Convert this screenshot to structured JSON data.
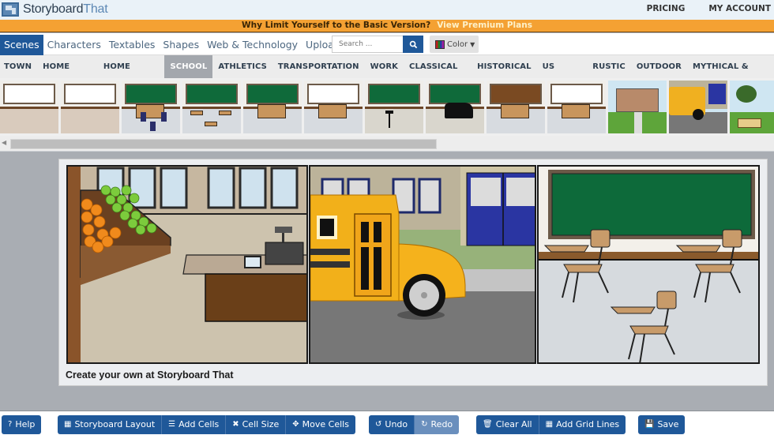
{
  "header": {
    "brand_main": "Storyboard",
    "brand_accent": "That",
    "links": [
      "PRICING",
      "MY ACCOUNT"
    ]
  },
  "promo": {
    "text": "Why Limit Yourself to the Basic Version?",
    "cta": "View Premium Plans"
  },
  "library": {
    "tabs": [
      "Scenes",
      "Characters",
      "Textables",
      "Shapes",
      "Web & Technology",
      "Upload"
    ],
    "active_tab": "Scenes",
    "search_placeholder": "Search ...",
    "color_label": "Color"
  },
  "categories": {
    "items": [
      "TOWN",
      "HOME (INDOOR)",
      "HOME (OUTDOOR)",
      "SCHOOL",
      "ATHLETICS",
      "TRANSPORTATION",
      "WORK",
      "CLASSICAL HOMES",
      "HISTORICAL",
      "US HISTORY",
      "RUSTIC",
      "OUTDOOR",
      "MYTHICAL & FUTURISTIC"
    ],
    "active": "SCHOOL"
  },
  "thumbnails": [
    {
      "name": "cafeteria-whiteboard",
      "board": "#ffffff",
      "floor": "#d9cbbd"
    },
    {
      "name": "art-room",
      "board": "#ffffff",
      "floor": "#d9cbbd"
    },
    {
      "name": "classroom-desks",
      "board": "#0f6a3a",
      "floor": "#d7dbe0"
    },
    {
      "name": "classroom-chairs",
      "board": "#0f6a3a",
      "floor": "#d7dbe0"
    },
    {
      "name": "classroom-teacher-desk",
      "board": "#0f6a3a",
      "floor": "#d7dbe0"
    },
    {
      "name": "whiteboard-teacher-desk",
      "board": "#ffffff",
      "floor": "#d7dbe0"
    },
    {
      "name": "music-room-stands",
      "board": "#0f6a3a",
      "floor": "#d9d6cd"
    },
    {
      "name": "music-room-piano",
      "board": "#0f6a3a",
      "floor": "#d9d6cd"
    },
    {
      "name": "science-cabinets",
      "board": "#7a4a22",
      "floor": "#d7dbe0"
    },
    {
      "name": "science-lab",
      "board": "#ffffff",
      "floor": "#d7dbe0"
    },
    {
      "name": "school-exterior",
      "board": "#b88a6a",
      "floor": "#5ea53a"
    },
    {
      "name": "school-bus",
      "board": "#f0b020",
      "floor": "#777777"
    },
    {
      "name": "playground",
      "board": "#cfe6f2",
      "floor": "#5ea53a"
    }
  ],
  "storyboard": {
    "cells": [
      {
        "name": "grocery-store",
        "scene": "Town"
      },
      {
        "name": "school-bus",
        "scene": "School"
      },
      {
        "name": "classroom",
        "scene": "School"
      }
    ],
    "watermark": "Create your own at Storyboard That"
  },
  "toolbar": {
    "help": "Help",
    "layout_group": [
      "Storyboard Layout",
      "Add Cells",
      "Cell Size",
      "Move Cells"
    ],
    "history_group": [
      "Undo",
      "Redo"
    ],
    "edit_group": [
      "Clear All",
      "Add Grid Lines"
    ],
    "save": "Save"
  },
  "colors": {
    "primary": "#1f5899",
    "promo": "#f4a133",
    "chalkboard": "#0f6a3a"
  }
}
